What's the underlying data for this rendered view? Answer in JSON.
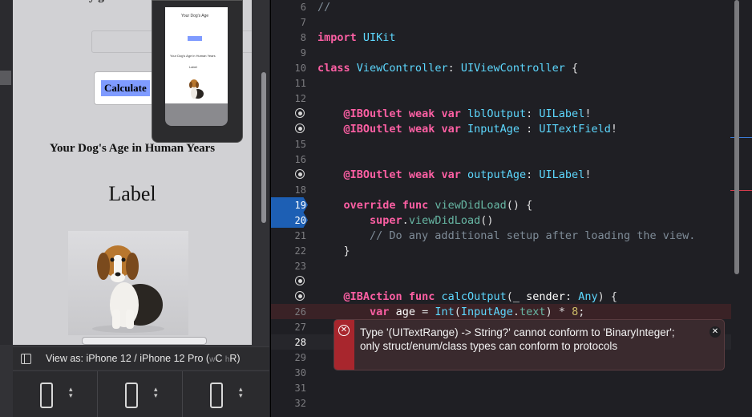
{
  "ib": {
    "title_cut": "y g",
    "calculate_label": "Calculate",
    "headline": "Your Dog's Age in Human Years",
    "label_text": "Label",
    "view_as_prefix": "View as: iPhone 12 / iPhone 12 Pro (",
    "view_as_w": "w",
    "view_as_c": "C",
    "view_as_h": "h",
    "view_as_r": "R)",
    "preview_title": "Your Dog's Age",
    "preview_headline": "Your Dog's Age in Human Years",
    "preview_label": "Label"
  },
  "editor": {
    "lines": [
      {
        "n": "6",
        "code": "//"
      },
      {
        "n": "7",
        "code": ""
      },
      {
        "n": "8",
        "code": "import UIKit"
      },
      {
        "n": "9",
        "code": ""
      },
      {
        "n": "10",
        "code": "class ViewController: UIViewController {"
      },
      {
        "n": "11",
        "code": ""
      },
      {
        "n": "12",
        "code": ""
      },
      {
        "n": "13",
        "code": "    @IBOutlet weak var lblOutput: UILabel!"
      },
      {
        "n": "14",
        "code": "    @IBOutlet weak var InputAge : UITextField!"
      },
      {
        "n": "15",
        "code": ""
      },
      {
        "n": "16",
        "code": ""
      },
      {
        "n": "17",
        "code": "    @IBOutlet weak var outputAge: UILabel!"
      },
      {
        "n": "18",
        "code": ""
      },
      {
        "n": "19",
        "code": "    override func viewDidLoad() {"
      },
      {
        "n": "20",
        "code": "        super.viewDidLoad()"
      },
      {
        "n": "21",
        "code": "        // Do any additional setup after loading the view."
      },
      {
        "n": "22",
        "code": "    }"
      },
      {
        "n": "23",
        "code": ""
      },
      {
        "n": "24",
        "code": ""
      },
      {
        "n": "25",
        "code": "    @IBAction func calcOutput(_ sender: Any) {"
      },
      {
        "n": "26",
        "code": "        var age = Int(InputAge.text) * 8;"
      },
      {
        "n": "27",
        "code": ""
      },
      {
        "n": "28",
        "code": ""
      },
      {
        "n": "29",
        "code": ""
      },
      {
        "n": "30",
        "code": ""
      },
      {
        "n": "31",
        "code": ""
      },
      {
        "n": "32",
        "code": ""
      }
    ],
    "error_message": "Type '(UITextRange) -> String?' cannot conform to 'BinaryInteger'; only struct/enum/class types can conform to protocols",
    "error_icon": "x-circle-icon",
    "close_icon": "close-icon"
  },
  "colors": {
    "keyword": "#fc5fa3",
    "type": "#5dd8ff",
    "breakpoint": "#1d5fb4",
    "error": "#a8262d"
  }
}
